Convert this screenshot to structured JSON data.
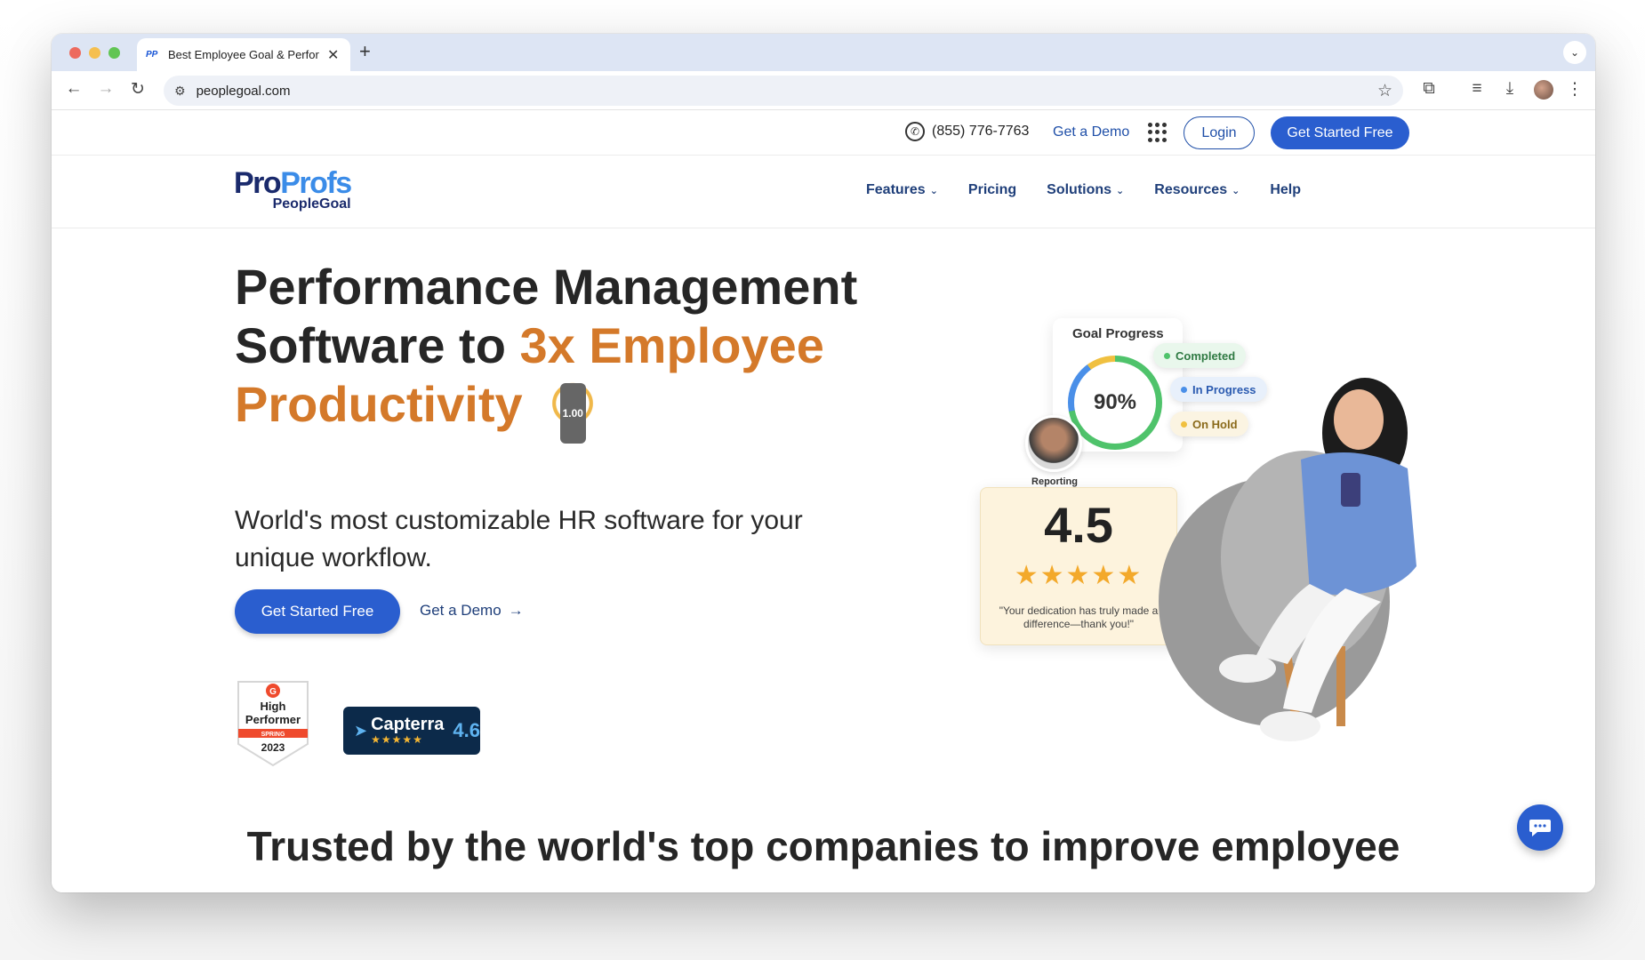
{
  "browser": {
    "tab_title": "Best Employee Goal & Perform",
    "tab_favicon": "PP",
    "url": "peoplegoal.com"
  },
  "topbar": {
    "phone": "(855) 776-7763",
    "demo": "Get a Demo",
    "login": "Login",
    "cta": "Get Started Free"
  },
  "logo": {
    "pro": "Pro",
    "profs": "Profs",
    "sub": "PeopleGoal"
  },
  "nav": {
    "features": "Features",
    "pricing": "Pricing",
    "solutions": "Solutions",
    "resources": "Resources",
    "help": "Help"
  },
  "hero": {
    "line1": "Performance Management",
    "line2_plain": "Software to ",
    "line2_accent": "3x Employee",
    "line3_accent": "Productivity",
    "subtitle": "World's most customizable HR software for your unique workflow.",
    "cta": "Get Started Free",
    "demo": "Get a Demo",
    "demo_arrow": "→"
  },
  "badges": {
    "g2_line1": "High",
    "g2_line2": "Performer",
    "g2_season": "SPRING",
    "g2_year": "2023",
    "capterra_name": "Capterra",
    "capterra_stars": "★★★★★",
    "capterra_rating": "4.6"
  },
  "illustration": {
    "goal_title": "Goal Progress",
    "goal_percent": "90%",
    "goal_progress_fraction": 0.9,
    "status_completed": "Completed",
    "status_in_progress": "In Progress",
    "status_on_hold": "On Hold",
    "manager_label": "Reporting Manager",
    "rating": "4.5",
    "stars": "★★★★★",
    "quote": "\"Your dedication has truly made a difference—thank you!\""
  },
  "trusted_heading": "Trusted by the world's top companies to improve employee",
  "colors": {
    "brand_blue": "#2a5ecf",
    "accent_orange": "#d4792a",
    "nav_blue": "#1f3f7a"
  }
}
